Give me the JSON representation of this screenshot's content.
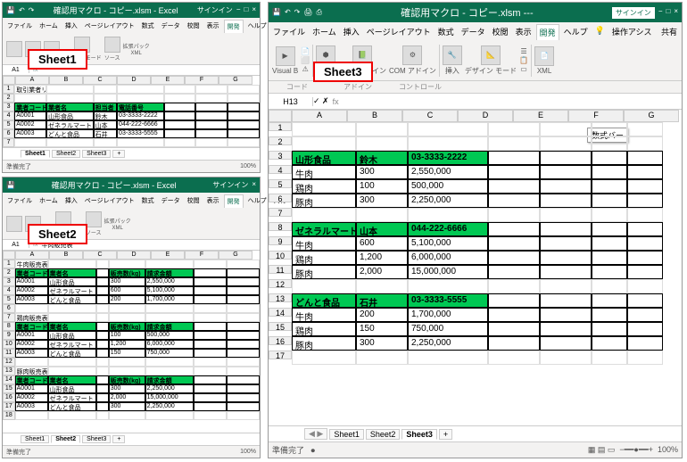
{
  "app": {
    "title_small": "確認用マクロ - コピー.xlsm - Excel",
    "title_big": "確認用マクロ - コピー.xlsm ---",
    "signin": "サインイン"
  },
  "menu": {
    "file": "ファイル",
    "home": "ホーム",
    "insert": "挿入",
    "layout": "ページレイアウト",
    "formula": "数式",
    "data": "データ",
    "review": "校閲",
    "view": "表示",
    "dev": "開発",
    "help": "ヘルプ",
    "search": "操作アシス",
    "share": "共有"
  },
  "ribbon": {
    "vb": "Visual B",
    "code": "コード",
    "addin": "イン",
    "excel_addin": "Excel\nアドイン",
    "com_addin": "COM\nアドイン",
    "addin_grp": "アドイン",
    "insert": "挿入",
    "design": "デザイン\nモード",
    "control": "コントロール",
    "source": "ソース",
    "xml": "XML",
    "expand": "拡張パック"
  },
  "labels": {
    "s1": "Sheet1",
    "s2": "Sheet2",
    "s3": "Sheet3"
  },
  "cells": {
    "a1": "A1",
    "h13": "H13"
  },
  "sheet1": {
    "title": "取引業者リスト",
    "hdr": [
      "業者コード",
      "業者名",
      "担当者",
      "電話番号"
    ],
    "rows": [
      [
        "A0001",
        "山形食品",
        "鈴木",
        "03-3333-2222"
      ],
      [
        "A0002",
        "ゼネラルマート",
        "山本",
        "044-222-6666"
      ],
      [
        "A0003",
        "どんと食品",
        "石井",
        "03-3333-5555"
      ]
    ]
  },
  "sheet2": {
    "title_main": "牛肉販売表",
    "sec1": {
      "title": "牛肉販売表",
      "hdr": [
        "業者コード",
        "業者名",
        "",
        "販売数(kg)",
        "請求金額"
      ],
      "rows": [
        [
          "A0001",
          "山形食品",
          "",
          "300",
          "2,550,000"
        ],
        [
          "A0002",
          "ゼネラルマート",
          "",
          "600",
          "5,100,000"
        ],
        [
          "A0003",
          "どんと食品",
          "",
          "200",
          "1,700,000"
        ]
      ]
    },
    "sec2": {
      "title": "鶏肉販売表",
      "hdr": [
        "業者コード",
        "業者名",
        "",
        "販売数(kg)",
        "請求金額"
      ],
      "rows": [
        [
          "A0001",
          "山形食品",
          "",
          "100",
          "500,000"
        ],
        [
          "A0002",
          "ゼネラルマート",
          "",
          "1,200",
          "6,000,000"
        ],
        [
          "A0003",
          "どんと食品",
          "",
          "150",
          "750,000"
        ]
      ]
    },
    "sec3": {
      "title": "豚肉販売表",
      "hdr": [
        "業者コード",
        "業者名",
        "",
        "販売数(kg)",
        "請求金額"
      ],
      "rows": [
        [
          "A0001",
          "山形食品",
          "",
          "300",
          "2,250,000"
        ],
        [
          "A0002",
          "ゼネラルマート",
          "",
          "2,000",
          "15,000,000"
        ],
        [
          "A0003",
          "どんと食品",
          "",
          "300",
          "2,250,000"
        ]
      ]
    }
  },
  "sheet3": {
    "groups": [
      {
        "hdr": [
          "山形食品",
          "鈴木",
          "03-3333-2222"
        ],
        "rows": [
          [
            "牛肉",
            "300",
            "2,550,000"
          ],
          [
            "鶏肉",
            "100",
            "500,000"
          ],
          [
            "豚肉",
            "300",
            "2,250,000"
          ]
        ]
      },
      {
        "hdr": [
          "ゼネラルマート",
          "山本",
          "044-222-6666"
        ],
        "rows": [
          [
            "牛肉",
            "600",
            "5,100,000"
          ],
          [
            "鶏肉",
            "1,200",
            "6,000,000"
          ],
          [
            "豚肉",
            "2,000",
            "15,000,000"
          ]
        ]
      },
      {
        "hdr": [
          "どんと食品",
          "石井",
          "03-3333-5555"
        ],
        "rows": [
          [
            "牛肉",
            "200",
            "1,700,000"
          ],
          [
            "鶏肉",
            "150",
            "750,000"
          ],
          [
            "豚肉",
            "300",
            "2,250,000"
          ]
        ]
      }
    ]
  },
  "status": {
    "ready": "準備完了",
    "zoom": "100%",
    "rec": ""
  },
  "tooltip": "数式バー",
  "sheets": {
    "s1": "Sheet1",
    "s2": "Sheet2",
    "s3": "Sheet3",
    "plus": "+"
  },
  "cols_small": [
    "",
    "A",
    "B",
    "C",
    "D",
    "E",
    "F",
    "G"
  ],
  "cols_big": [
    "",
    "A",
    "B",
    "C",
    "D",
    "E",
    "F",
    "G"
  ]
}
